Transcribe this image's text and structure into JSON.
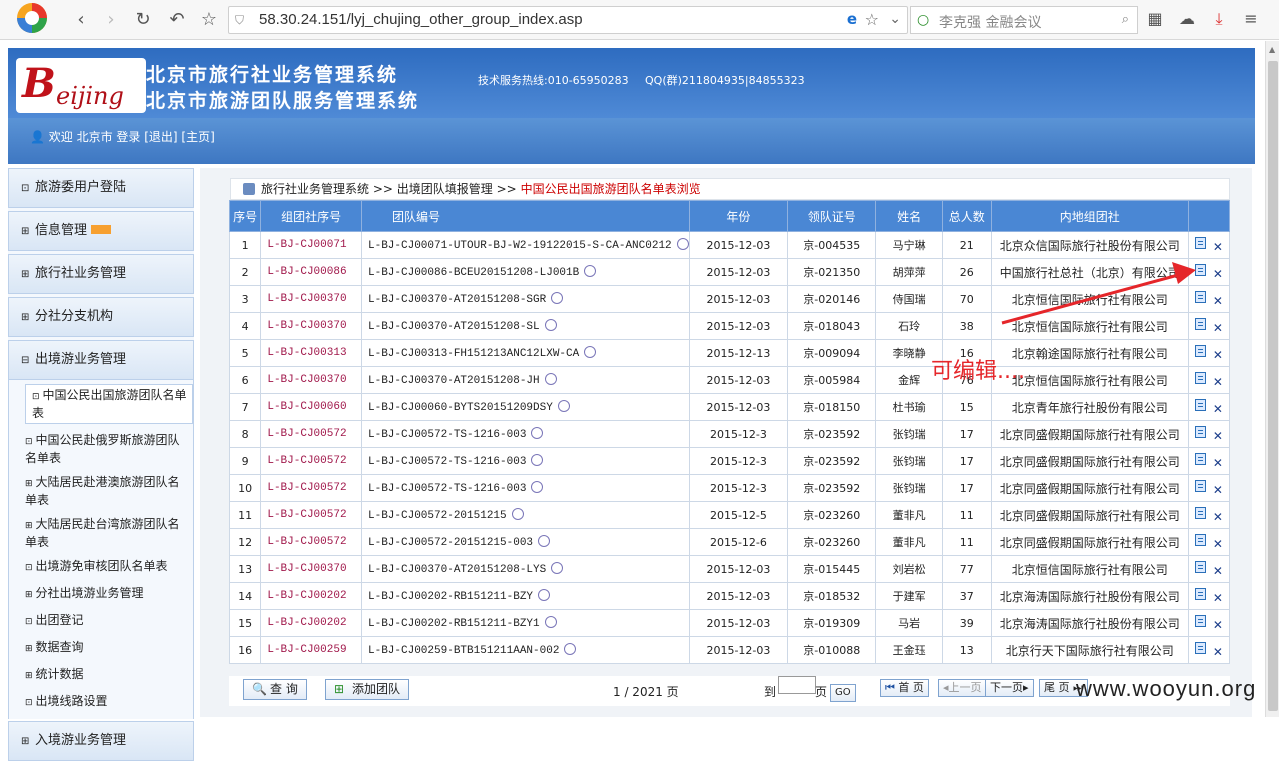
{
  "browser": {
    "url": "58.30.24.151/lyj_chujing_other_group_index.asp",
    "search_placeholder": "李克强 金融会议"
  },
  "header": {
    "title1": "北京市旅行社业务管理系统",
    "title2": "北京市旅游团队服务管理系统",
    "hotline": "技术服务热线:010-65950283",
    "qq": "QQ(群)211804935|84855323",
    "welcome": "欢迎 北京市 登录 [退出] [主页]",
    "brand_big": "B",
    "brand_text": "eijing"
  },
  "sidebar": {
    "items": [
      {
        "label": "旅游委用户登陆",
        "pm": "⊡"
      },
      {
        "label": "信息管理",
        "pm": "⊞"
      },
      {
        "label": "旅行社业务管理",
        "pm": "⊞"
      },
      {
        "label": "分社分支机构",
        "pm": "⊞"
      },
      {
        "label": "出境游业务管理",
        "pm": "⊟"
      }
    ],
    "subs": [
      {
        "label": "中国公民出国旅游团队名单表",
        "pm": "⊡",
        "active": true
      },
      {
        "label": "中国公民赴俄罗斯旅游团队名单表",
        "pm": "⊡"
      },
      {
        "label": "大陆居民赴港澳旅游团队名单表",
        "pm": "⊞"
      },
      {
        "label": "大陆居民赴台湾旅游团队名单表",
        "pm": "⊞"
      },
      {
        "label": "出境游免审核团队名单表",
        "pm": "⊡"
      },
      {
        "label": "分社出境游业务管理",
        "pm": "⊞"
      },
      {
        "label": "出团登记",
        "pm": "⊡"
      },
      {
        "label": "数据查询",
        "pm": "⊞"
      },
      {
        "label": "统计数据",
        "pm": "⊞"
      },
      {
        "label": "出境线路设置",
        "pm": "⊡"
      }
    ],
    "last": {
      "label": "入境游业务管理",
      "pm": "⊞"
    }
  },
  "breadcrumb": {
    "a": "旅行社业务管理系统",
    "sep": ">>",
    "b": "出境团队填报管理",
    "c": "中国公民出国旅游团队名单表浏览"
  },
  "table": {
    "headers": [
      "序号",
      "组团社序号",
      "团队编号",
      "年份",
      "领队证号",
      "姓名",
      "总人数",
      "内地组团社",
      ""
    ],
    "rows": [
      [
        "1",
        "L-BJ-CJ00071",
        "L-BJ-CJ00071-UTOUR-BJ-W2-19122015-S-CA-ANC0212",
        "2015-12-03",
        "京-004535",
        "马宁琳",
        "21",
        "北京众信国际旅行社股份有限公司"
      ],
      [
        "2",
        "L-BJ-CJ00086",
        "L-BJ-CJ00086-BCEU20151208-LJ001B",
        "2015-12-03",
        "京-021350",
        "胡萍萍",
        "26",
        "中国旅行社总社（北京）有限公司"
      ],
      [
        "3",
        "L-BJ-CJ00370",
        "L-BJ-CJ00370-AT20151208-SGR",
        "2015-12-03",
        "京-020146",
        "侍国瑞",
        "70",
        "北京恒信国际旅行社有限公司"
      ],
      [
        "4",
        "L-BJ-CJ00370",
        "L-BJ-CJ00370-AT20151208-SL",
        "2015-12-03",
        "京-018043",
        "石玲",
        "38",
        "北京恒信国际旅行社有限公司"
      ],
      [
        "5",
        "L-BJ-CJ00313",
        "L-BJ-CJ00313-FH151213ANC12LXW-CA",
        "2015-12-13",
        "京-009094",
        "李晓静",
        "16",
        "北京翰途国际旅行社有限公司"
      ],
      [
        "6",
        "L-BJ-CJ00370",
        "L-BJ-CJ00370-AT20151208-JH",
        "2015-12-03",
        "京-005984",
        "金辉",
        "76",
        "北京恒信国际旅行社有限公司"
      ],
      [
        "7",
        "L-BJ-CJ00060",
        "L-BJ-CJ00060-BYTS20151209DSY",
        "2015-12-03",
        "京-018150",
        "杜书瑜",
        "15",
        "北京青年旅行社股份有限公司"
      ],
      [
        "8",
        "L-BJ-CJ00572",
        "L-BJ-CJ00572-TS-1216-003",
        "2015-12-3",
        "京-023592",
        "张钧瑞",
        "17",
        "北京同盛假期国际旅行社有限公司"
      ],
      [
        "9",
        "L-BJ-CJ00572",
        "L-BJ-CJ00572-TS-1216-003",
        "2015-12-3",
        "京-023592",
        "张钧瑞",
        "17",
        "北京同盛假期国际旅行社有限公司"
      ],
      [
        "10",
        "L-BJ-CJ00572",
        "L-BJ-CJ00572-TS-1216-003",
        "2015-12-3",
        "京-023592",
        "张钧瑞",
        "17",
        "北京同盛假期国际旅行社有限公司"
      ],
      [
        "11",
        "L-BJ-CJ00572",
        "L-BJ-CJ00572-20151215",
        "2015-12-5",
        "京-023260",
        "董非凡",
        "11",
        "北京同盛假期国际旅行社有限公司"
      ],
      [
        "12",
        "L-BJ-CJ00572",
        "L-BJ-CJ00572-20151215-003",
        "2015-12-6",
        "京-023260",
        "董非凡",
        "11",
        "北京同盛假期国际旅行社有限公司"
      ],
      [
        "13",
        "L-BJ-CJ00370",
        "L-BJ-CJ00370-AT20151208-LYS",
        "2015-12-03",
        "京-015445",
        "刘岩松",
        "77",
        "北京恒信国际旅行社有限公司"
      ],
      [
        "14",
        "L-BJ-CJ00202",
        "L-BJ-CJ00202-RB151211-BZY",
        "2015-12-03",
        "京-018532",
        "于建军",
        "37",
        "北京海涛国际旅行社股份有限公司"
      ],
      [
        "15",
        "L-BJ-CJ00202",
        "L-BJ-CJ00202-RB151211-BZY1",
        "2015-12-03",
        "京-019309",
        "马岩",
        "39",
        "北京海涛国际旅行社股份有限公司"
      ],
      [
        "16",
        "L-BJ-CJ00259",
        "L-BJ-CJ00259-BTB151211AAN-002",
        "2015-12-03",
        "京-010088",
        "王金珏",
        "13",
        "北京行天下国际旅行社有限公司"
      ]
    ]
  },
  "footer": {
    "search_btn": "查 询",
    "add_btn": "添加团队",
    "page_info": "1 / 2021 页",
    "goto_prefix": "到",
    "goto_suffix": "页",
    "go_btn": "GO",
    "first": "首 页",
    "prev": "上一页",
    "next": "下一页",
    "last": "尾 页"
  },
  "annotation": "可编辑....",
  "watermark": "www.wooyun.org",
  "colors": {
    "header_blue": "#3c7ac8",
    "table_head": "#4a87d4",
    "annotation_red": "#e5262a"
  }
}
